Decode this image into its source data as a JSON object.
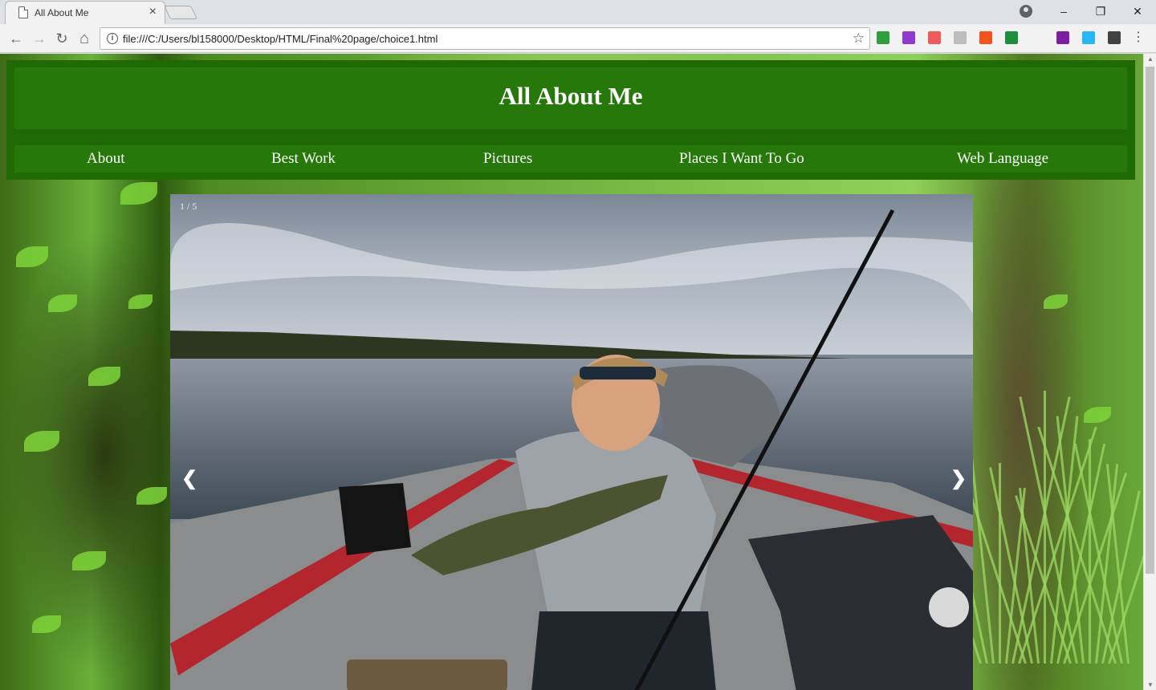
{
  "browser": {
    "tab_title": "All About Me",
    "tab_close": "×",
    "url": "file:///C:/Users/bl158000/Desktop/HTML/Final%20page/choice1.html",
    "window_controls": {
      "minimize": "–",
      "restore": "❐",
      "close": "✕"
    },
    "nav": {
      "back": "←",
      "forward": "→",
      "reload": "↻",
      "home": "⌂",
      "star": "☆",
      "info": "i",
      "menu": "⋮"
    },
    "extension_colors": [
      "#2e9e3e",
      "#8f3bd0",
      "#f05a5a",
      "#bdbdbd",
      "#f4511e",
      "#1e8e3e",
      "#7b1fa2",
      "#29b6f6",
      "#424242"
    ]
  },
  "site": {
    "title": "All About Me",
    "nav": [
      {
        "label": "About"
      },
      {
        "label": "Best Work"
      },
      {
        "label": "Pictures"
      },
      {
        "label": "Places I Want To Go"
      },
      {
        "label": "Web Language"
      }
    ]
  },
  "slideshow": {
    "counter": "1 / 5",
    "prev": "❮",
    "next": "❯",
    "image_icon": "photo-boy-holding-fish-on-boat"
  },
  "colors": {
    "header_outer": "#1f6a05",
    "header_inner": "#257809",
    "text": "#ffffff"
  }
}
